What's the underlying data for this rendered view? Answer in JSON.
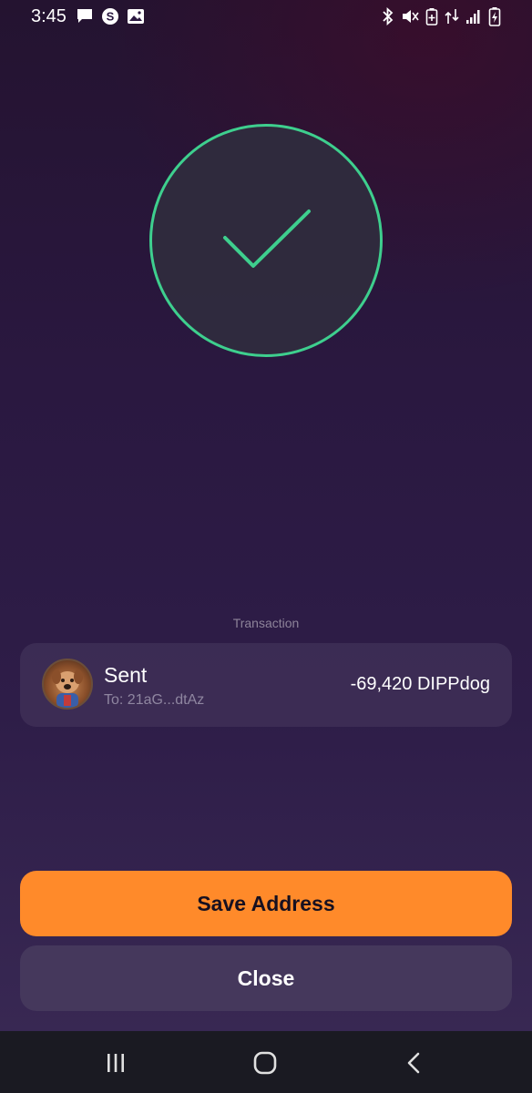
{
  "status_bar": {
    "time": "3:45",
    "left_icons": [
      "message-icon",
      "skype-icon",
      "image-icon"
    ],
    "right_icons": [
      "bluetooth-icon",
      "mute-icon",
      "battery-saver-icon",
      "data-icon",
      "signal-icon",
      "battery-icon"
    ]
  },
  "success": {
    "icon": "checkmark-icon",
    "color": "#3ecf8e"
  },
  "transaction": {
    "section_label": "Transaction",
    "title": "Sent",
    "to": "To: 21aG...dtAz",
    "amount": "-69,420 DIPPdog",
    "avatar": "token-avatar"
  },
  "actions": {
    "save_label": "Save Address",
    "close_label": "Close",
    "accent": "#ff8a2a"
  },
  "nav": {
    "icons": [
      "recent-apps-icon",
      "home-icon",
      "back-icon"
    ]
  }
}
